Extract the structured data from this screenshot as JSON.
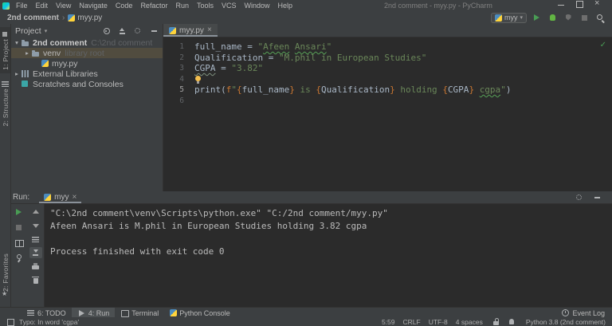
{
  "titlebar": {
    "menus": [
      "File",
      "Edit",
      "View",
      "Navigate",
      "Code",
      "Refactor",
      "Run",
      "Tools",
      "VCS",
      "Window",
      "Help"
    ],
    "title": "2nd comment - myy.py - PyCharm",
    "window_controls": [
      "minimize-icon",
      "maximize-icon",
      "close-icon"
    ]
  },
  "navbar": {
    "breadcrumb": {
      "project": "2nd comment",
      "file": "myy.py"
    },
    "run_config": {
      "name": "myy"
    },
    "toolbar_icons": [
      "run-icon",
      "debug-icon",
      "coverage-icon",
      "stop-icon",
      "search-everywhere-icon"
    ]
  },
  "sidebar": {
    "left_top": [
      {
        "icon": "project-tool-icon",
        "label": "1: Project",
        "active": true
      },
      {
        "icon": "structure-tool-icon",
        "label": "2: Structure",
        "active": false
      }
    ],
    "left_bottom": [
      {
        "icon": "favorites-tool-icon",
        "label": "2: Favorites",
        "active": false
      }
    ]
  },
  "project": {
    "header": {
      "title": "Project",
      "icons": [
        "select-opened-file-icon",
        "collapse-all-icon",
        "settings-icon",
        "hide-icon"
      ]
    },
    "tree": [
      {
        "chevron": "down",
        "icon": "folder-icon",
        "label": "2nd comment",
        "detail": "C:\\2nd comment",
        "bold": true,
        "selected": false,
        "indent": 0
      },
      {
        "chevron": "right",
        "icon": "folder-icon",
        "label": "venv",
        "detail": "library root",
        "bold": false,
        "selected": true,
        "indent": 1
      },
      {
        "chevron": "",
        "icon": "python-icon",
        "label": "myy.py",
        "detail": "",
        "bold": false,
        "selected": false,
        "indent": 2
      },
      {
        "chevron": "right",
        "icon": "library-icon",
        "label": "External Libraries",
        "detail": "",
        "bold": false,
        "selected": false,
        "indent": 0
      },
      {
        "chevron": "",
        "icon": "scratches-icon",
        "label": "Scratches and Consoles",
        "detail": "",
        "bold": false,
        "selected": false,
        "indent": 0
      }
    ]
  },
  "editor": {
    "tab": {
      "label": "myy.py",
      "icon": "python-icon"
    },
    "code": {
      "active_line": "5",
      "lines": [
        {
          "num": "1",
          "tokens": [
            [
              "v",
              "full_name"
            ],
            [
              "v",
              " = "
            ],
            [
              "s",
              "\""
            ],
            [
              "st",
              "Afeen"
            ],
            [
              "s",
              " "
            ],
            [
              "st",
              "Ansari"
            ],
            [
              "s",
              "\""
            ]
          ]
        },
        {
          "num": "2",
          "tokens": [
            [
              "v",
              "Qualification"
            ],
            [
              "v",
              " = "
            ],
            [
              "s",
              "\"M.phil in European Studies\""
            ]
          ]
        },
        {
          "num": "3",
          "tokens": [
            [
              "vt",
              "CGPA"
            ],
            [
              "v",
              " = "
            ],
            [
              "s",
              "\"3.82\""
            ]
          ]
        },
        {
          "num": "4",
          "tokens": [
            [
              "bulb",
              ""
            ]
          ]
        },
        {
          "num": "5",
          "tokens": [
            [
              "v",
              "print("
            ],
            [
              "b",
              "f"
            ],
            [
              "s",
              "\""
            ],
            [
              "b",
              "{"
            ],
            [
              "v",
              "full_name"
            ],
            [
              "b",
              "}"
            ],
            [
              "s",
              " is "
            ],
            [
              "b",
              "{"
            ],
            [
              "v",
              "Qualification"
            ],
            [
              "b",
              "}"
            ],
            [
              "s",
              " holding "
            ],
            [
              "b",
              "{"
            ],
            [
              "v",
              "CGPA"
            ],
            [
              "b",
              "}"
            ],
            [
              "s",
              " "
            ],
            [
              "st",
              "cgpa"
            ],
            [
              "s",
              "\""
            ],
            [
              "v",
              ")"
            ]
          ]
        },
        {
          "num": "6",
          "tokens": []
        }
      ]
    }
  },
  "run": {
    "label": "Run:",
    "tab": {
      "label": "myy",
      "icon": "python-icon"
    },
    "header_icons": [
      "settings-icon",
      "hide-icon"
    ],
    "toolbar": {
      "left_icons": [
        "rerun-icon",
        "stop-icon",
        "restore-layout-icon",
        "pin-tab-icon"
      ],
      "console_icons": [
        "up-stack-trace-icon",
        "down-stack-trace-icon",
        "soft-wrap-icon",
        "scroll-to-end-icon",
        "print-icon",
        "clear-all-icon"
      ]
    },
    "output": [
      "\"C:\\2nd comment\\venv\\Scripts\\python.exe\" \"C:/2nd comment/myy.py\"",
      "Afeen Ansari is M.phil in European Studies holding 3.82 cgpa",
      "",
      "Process finished with exit code 0"
    ]
  },
  "bottom_bar": {
    "tools": [
      {
        "icon": "todo-icon",
        "label": "6: TODO",
        "active": false
      },
      {
        "icon": "run-icon",
        "label": "4: Run",
        "active": true
      },
      {
        "icon": "terminal-icon",
        "label": "Terminal",
        "active": false
      },
      {
        "icon": "python-icon",
        "label": "Python Console",
        "active": false
      }
    ],
    "event_log": {
      "icon": "event-log-icon",
      "label": "Event Log"
    }
  },
  "status_bar": {
    "message": "Typo: In word 'cgpa'",
    "caret": "5:59",
    "line_separator": "CRLF",
    "encoding": "UTF-8",
    "indent": "4 spaces",
    "icons": [
      "readonly-lock-icon",
      "inspections-profile-icon"
    ],
    "interpreter": "Python 3.8 (2nd comment)"
  },
  "colors": {
    "panel_bg": "#3C3F41",
    "editor_bg": "#2B2B2B",
    "string_green": "#6A8759",
    "keyword_orange": "#CC7832",
    "code_text": "#A9B7C6",
    "run_green": "#499C54",
    "selected_row": "#514C3F",
    "typo_underline": "#56A156"
  }
}
